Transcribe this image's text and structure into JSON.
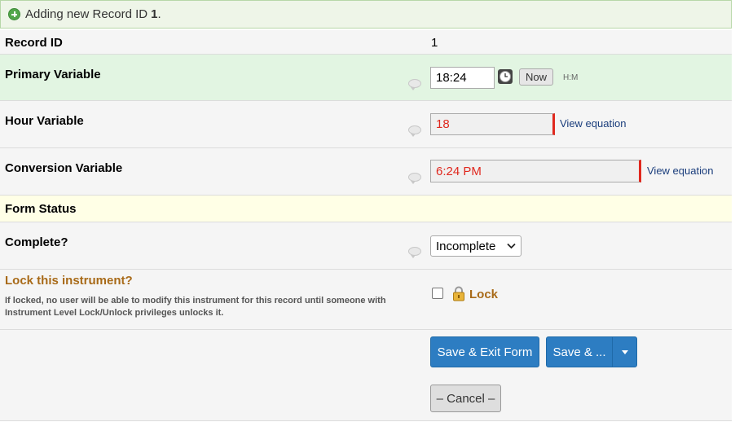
{
  "banner": {
    "text": "Adding new Record ID",
    "record_id": "1",
    "suffix": "."
  },
  "record": {
    "label": "Record ID",
    "value": "1"
  },
  "primary": {
    "label": "Primary Variable",
    "value": "18:24",
    "now_label": "Now",
    "format": "H:M"
  },
  "hour": {
    "label": "Hour Variable",
    "value": "18",
    "link": "View equation"
  },
  "conversion": {
    "label": "Conversion Variable",
    "value": "6:24 PM",
    "link": "View equation"
  },
  "form_status": {
    "label": "Form Status"
  },
  "complete": {
    "label": "Complete?",
    "selected": "Incomplete"
  },
  "lock": {
    "title": "Lock this instrument?",
    "description": "If locked, no user will be able to modify this instrument for this record until someone with Instrument Level Lock/Unlock privileges unlocks it.",
    "checkbox_label": "Lock",
    "checked": false
  },
  "buttons": {
    "save_exit": "Save & Exit Form",
    "save_more": "Save & ...",
    "cancel": "– Cancel –"
  },
  "colors": {
    "primary_row": "#e2f5e2",
    "status_row": "#ffffe6",
    "lock_title": "#a86a18",
    "primary_button": "#2d7dc2"
  }
}
